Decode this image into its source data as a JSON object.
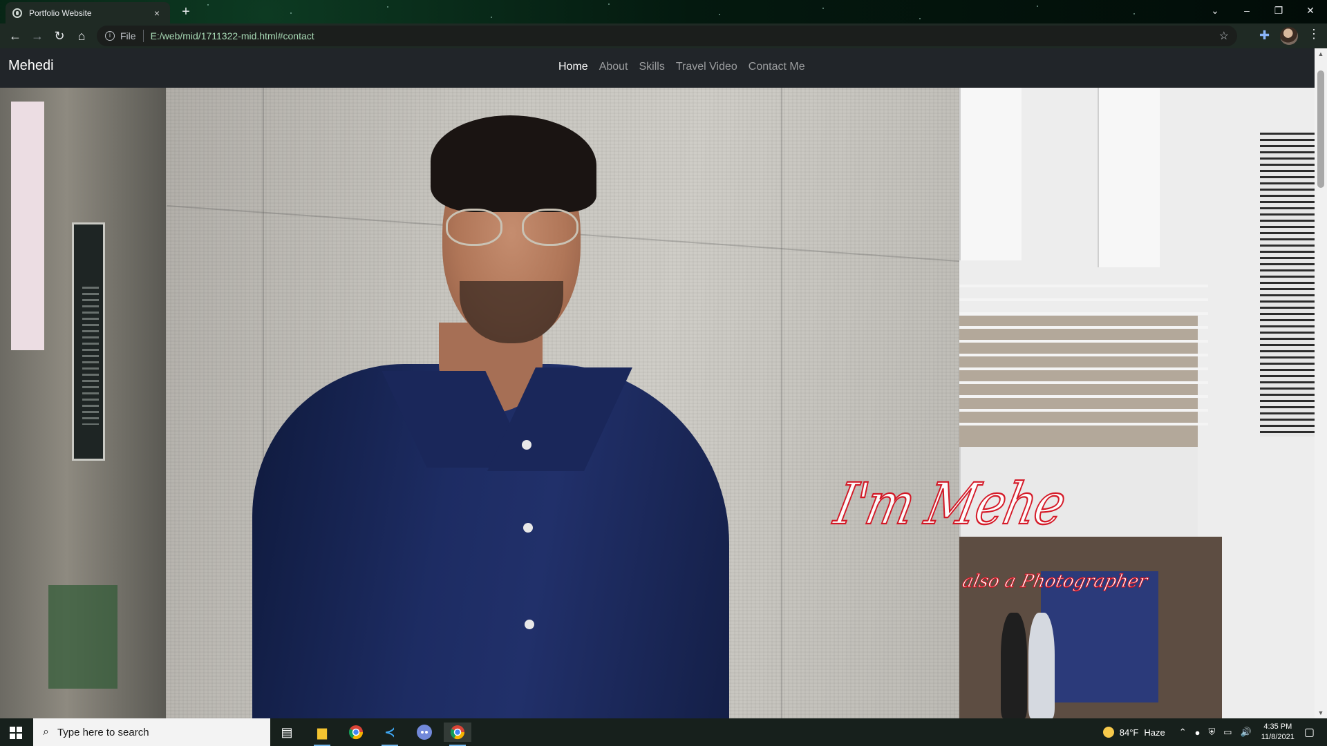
{
  "browser": {
    "tab_title": "Portfolio Website",
    "close_glyph": "×",
    "new_tab_glyph": "+",
    "scheme": "File",
    "url": "E:/web/mid/1711322-mid.html#contact",
    "icons": [
      "back-icon",
      "forward-icon",
      "reload-icon",
      "home-icon",
      "info-icon",
      "bookmark-star-icon",
      "extensions-icon",
      "profile-avatar",
      "menu-icon"
    ]
  },
  "site": {
    "brand": "Mehedi",
    "nav": [
      {
        "label": "Home",
        "active": true
      },
      {
        "label": "About",
        "active": false
      },
      {
        "label": "Skills",
        "active": false
      },
      {
        "label": "Travel Video",
        "active": false
      },
      {
        "label": "Contact Me",
        "active": false
      }
    ],
    "hero_title": "I'm Mehe",
    "hero_subtitle": "also a Photographer"
  },
  "taskbar": {
    "search_placeholder": "Type here to search",
    "apps": [
      "task-view-icon",
      "file-explorer-icon",
      "chrome-icon",
      "vscode-icon",
      "discord-icon",
      "chrome-active-icon"
    ],
    "weather_temp": "84°F",
    "weather_text": "Haze",
    "time": "4:35 PM",
    "date": "11/8/2021"
  },
  "colors": {
    "navbar_bg": "#212529",
    "accent_red": "#d4101f",
    "taskbar_bg": "#17201c"
  }
}
